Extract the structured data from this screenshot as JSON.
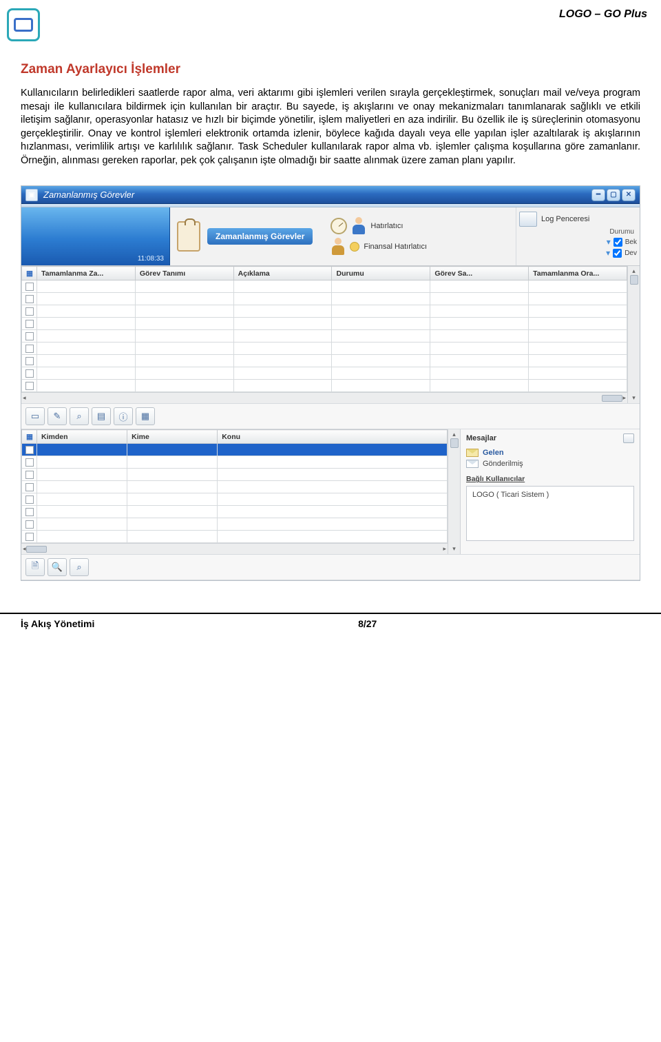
{
  "brand": "LOGO – GO Plus",
  "section_title": "Zaman Ayarlayıcı İşlemler",
  "body_text": "Kullanıcıların belirledikleri saatlerde rapor alma, veri aktarımı gibi işlemleri verilen sırayla gerçekleştirmek, sonuçları mail ve/veya program mesajı ile kullanıcılara bildirmek için kullanılan bir araçtır. Bu sayede, iş akışlarını ve onay mekanizmaları tanımlanarak sağlıklı ve etkili iletişim sağlanır, operasyonlar hatasız ve hızlı bir biçimde yönetilir, işlem maliyetleri en aza indirilir. Bu özellik ile iş süreçlerinin otomasyonu gerçekleştirilir. Onay ve kontrol işlemleri elektronik ortamda izlenir, böylece kağıda dayalı veya elle yapılan işler azaltılarak iş akışlarının hızlanması, verimlilik artışı ve karlılılık sağlanır. Task Scheduler kullanılarak rapor alma vb. işlemler çalışma koşullarına göre zamanlanır. Örneğin, alınması gereken raporlar, pek çok çalışanın işte olmadığı bir saatte alınmak üzere zaman planı yapılır.",
  "window": {
    "title": "Zamanlanmış Görevler",
    "time": "11:08:33",
    "center_label": "Zamanlanmış Görevler",
    "actions": {
      "reminder": "Hatırlatıcı",
      "financial_reminder": "Finansal Hatırlatıcı"
    },
    "right": {
      "log_window": "Log Penceresi",
      "status_label": "Durumu",
      "items": [
        "Bek",
        "Dev"
      ]
    },
    "grid1": {
      "cols": [
        "Tamamlanma Za...",
        "Görev Tanımı",
        "Açıklama",
        "Durumu",
        "Görev Sa...",
        "Tamamlanma Ora..."
      ],
      "rows": 9
    },
    "grid2": {
      "cols": [
        "Kimden",
        "Kime",
        "Konu"
      ],
      "rows": 8
    },
    "messages": {
      "header": "Mesajlar",
      "inbox": "Gelen",
      "sent": "Gönderilmiş",
      "users_header": "Bağlı Kullanıcılar",
      "user_entry": "LOGO ( Ticari Sistem )"
    }
  },
  "footer": {
    "left": "İş Akış Yönetimi",
    "page": "8/27"
  }
}
